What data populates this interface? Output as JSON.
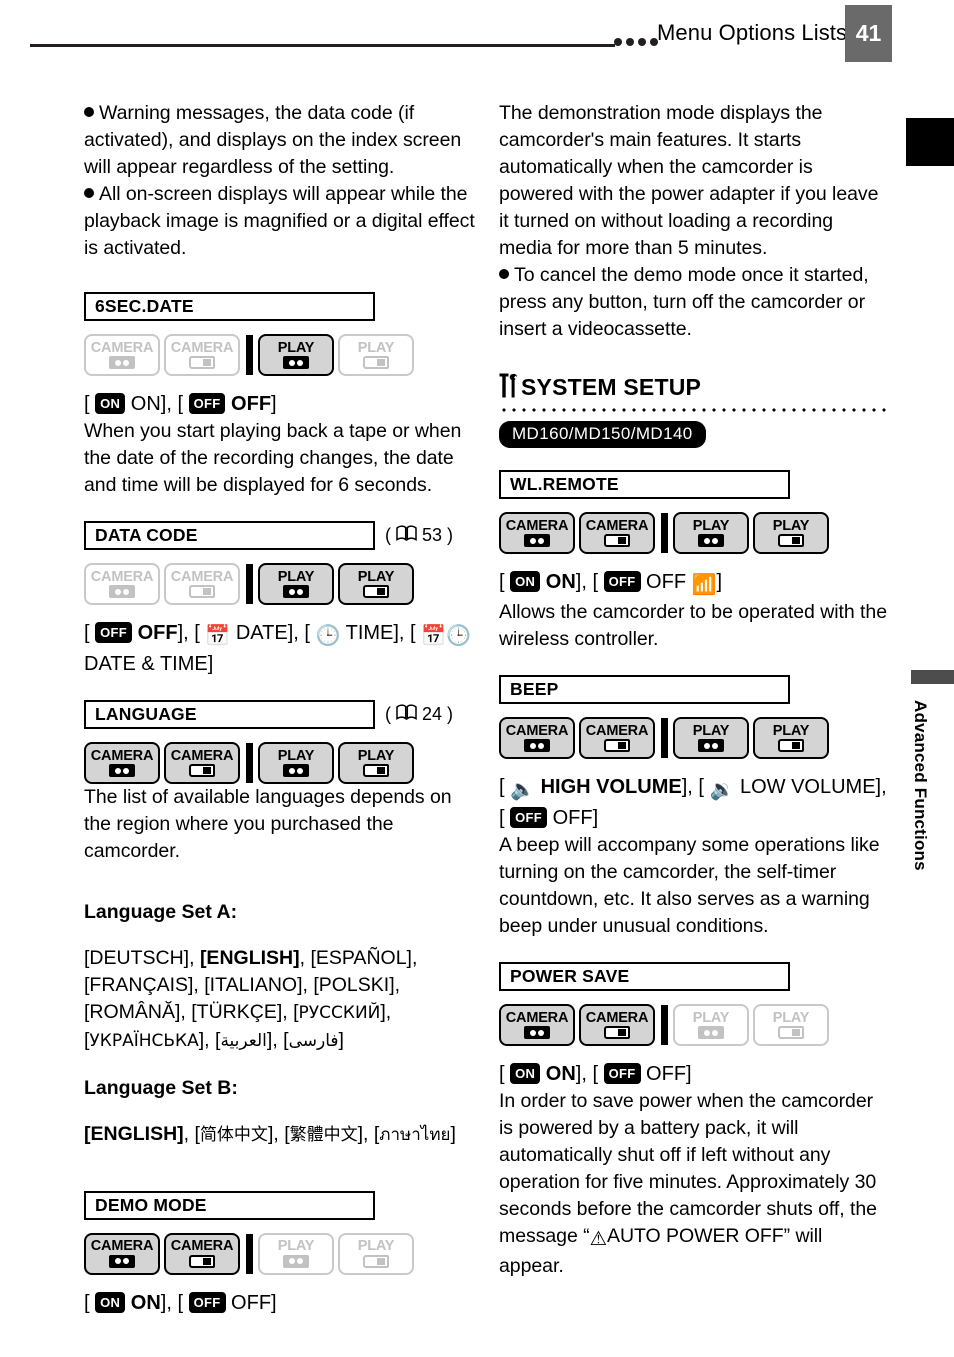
{
  "header": {
    "title": "Menu Options Lists",
    "page_number": "41",
    "dots_count": 4
  },
  "side_tab": {
    "vertical_label": "Advanced Functions"
  },
  "left_column": {
    "intro_bullets": [
      "Warning messages, the data code (if activated), and displays on the index screen will appear regardless of the setting.",
      "All on-screen displays will appear while the playback image is magnified or a digital effect is activated."
    ],
    "entries": [
      {
        "name": "6SEC.DATE",
        "page_ref": "",
        "modes": [
          {
            "label": "CAMERA",
            "icon": "tape-icon",
            "active": false
          },
          {
            "label": "CAMERA",
            "icon": "card-icon",
            "active": false
          },
          {
            "label": "PLAY",
            "icon": "tape-icon",
            "active": true
          },
          {
            "label": "PLAY",
            "icon": "card-icon",
            "active": false
          }
        ],
        "options_html": "[ <span class=\"pill\">ON</span> ON], [ <span class=\"pill\">OFF</span> <b>OFF</b>]",
        "description": "When you start playing back a tape or when the date of the recording changes, the date and time will be displayed for 6 seconds."
      },
      {
        "name": "DATA CODE",
        "page_ref": "53",
        "modes": [
          {
            "label": "CAMERA",
            "icon": "tape-icon",
            "active": false
          },
          {
            "label": "CAMERA",
            "icon": "card-icon",
            "active": false
          },
          {
            "label": "PLAY",
            "icon": "tape-icon",
            "active": true
          },
          {
            "label": "PLAY",
            "icon": "card-icon",
            "active": true
          }
        ],
        "options_html": "[ <span class=\"pill\">OFF</span> <b>OFF</b>], [ <span class=\"ic-inline\">&#x1F4C5;</span> DATE], [ <span class=\"ic-inline\">&#x1F552;</span> TIME], [ <span class=\"ic-inline\">&#x1F4C5;&#x1F552;</span> DATE &amp; TIME]",
        "description": ""
      },
      {
        "name": "LANGUAGE",
        "page_ref": "24",
        "modes": [
          {
            "label": "CAMERA",
            "icon": "tape-icon",
            "active": true
          },
          {
            "label": "CAMERA",
            "icon": "card-icon",
            "active": true
          },
          {
            "label": "PLAY",
            "icon": "tape-icon",
            "active": true
          },
          {
            "label": "PLAY",
            "icon": "card-icon",
            "active": true
          }
        ],
        "options_html": "",
        "description": "The list of available languages depends on the region where you purchased the camcorder."
      },
      {
        "name": "DEMO MODE",
        "page_ref": "",
        "modes": [
          {
            "label": "CAMERA",
            "icon": "tape-icon",
            "active": true
          },
          {
            "label": "CAMERA",
            "icon": "card-icon",
            "active": true
          },
          {
            "label": "PLAY",
            "icon": "tape-icon",
            "active": false
          },
          {
            "label": "PLAY",
            "icon": "card-icon",
            "active": false
          }
        ],
        "options_html": "[ <span class=\"pill\">ON</span> <b>ON</b>], [ <span class=\"pill\">OFF</span> OFF]",
        "description": ""
      }
    ],
    "language_sets": [
      {
        "heading": "Language Set A:",
        "items_html": "[DEUTSCH], <b>[ENGLISH]</b>, [ESPA&Ntilde;OL], [FRAN&Ccedil;AIS], [ITALIANO], [POLSKI], [ROM&Acirc;N&#258;], [T&Uuml;RK&Ccedil;E], [<span class=\"nonlatin\">&#1056;&#1059;&#1057;&#1057;&#1050;&#1048;&#1049;</span>], [<span class=\"nonlatin\">&#1059;&#1050;&#1056;&#1040;&#1031;&#1053;&#1057;&#1068;&#1050;&#1040;</span>], [<span class=\"nonlatin\">&#1575;&#1604;&#1593;&#1585;&#1576;&#1610;&#1577;</span>], [<span class=\"nonlatin\">&#1601;&#1575;&#1585;&#1587;&#1740;</span>]"
      },
      {
        "heading": "Language Set B:",
        "items_html": "<b>[ENGLISH]</b>, [<span class=\"nonlatin\">&#31616;&#20307;&#20013;&#25991;</span>], [<span class=\"nonlatin\">&#32321;&#39636;&#20013;&#25991;</span>], [<span class=\"nonlatin\">&#3616;&#3634;&#3625;&#3634;&#3652;&#3607;&#3618;</span>]"
      }
    ]
  },
  "right_column": {
    "intro_paragraph": "The demonstration mode displays the camcorder's main features. It starts automatically when the camcorder is powered with the power adapter if you leave it turned on without loading a recording media for more than 5 minutes.",
    "intro_bullet": "To cancel the demo mode once it started, press any button, turn off the camcorder or insert a videocassette.",
    "section": {
      "title": "SYSTEM SETUP",
      "icon": "screwdriver-wrench-icon",
      "model_badge": "MD160/MD150/MD140"
    },
    "entries": [
      {
        "name": "WL.REMOTE",
        "page_ref": "",
        "modes": [
          {
            "label": "CAMERA",
            "icon": "tape-icon",
            "active": true
          },
          {
            "label": "CAMERA",
            "icon": "card-icon",
            "active": true
          },
          {
            "label": "PLAY",
            "icon": "tape-icon",
            "active": true
          },
          {
            "label": "PLAY",
            "icon": "card-icon",
            "active": true
          }
        ],
        "options_html": "[ <span class=\"pill\">ON</span> <b>ON</b>], [ <span class=\"pill\">OFF</span> OFF <span class=\"ic-inline\" data-name=\"remote-off-icon\">&#128246;</span>]",
        "description": "Allows the camcorder to be operated with the wireless controller."
      },
      {
        "name": "BEEP",
        "page_ref": "",
        "modes": [
          {
            "label": "CAMERA",
            "icon": "tape-icon",
            "active": true
          },
          {
            "label": "CAMERA",
            "icon": "card-icon",
            "active": true
          },
          {
            "label": "PLAY",
            "icon": "tape-icon",
            "active": true
          },
          {
            "label": "PLAY",
            "icon": "card-icon",
            "active": true
          }
        ],
        "options_html": "[ <span class=\"ic-inline\" data-name=\"speaker-high-icon\">&#128264;</span> <b>HIGH VOLUME</b>], [ <span class=\"ic-inline\" data-name=\"speaker-low-icon\">&#128265;</span> LOW VOLUME], [ <span class=\"pill\">OFF</span> OFF]",
        "description": "A beep will accompany some operations like turning on the camcorder, the self-timer countdown, etc. It also serves as a warning beep under unusual conditions."
      },
      {
        "name": "POWER SAVE",
        "page_ref": "",
        "modes": [
          {
            "label": "CAMERA",
            "icon": "tape-icon",
            "active": true
          },
          {
            "label": "CAMERA",
            "icon": "card-icon",
            "active": true
          },
          {
            "label": "PLAY",
            "icon": "tape-icon",
            "active": false
          },
          {
            "label": "PLAY",
            "icon": "card-icon",
            "active": false
          }
        ],
        "options_html": "[ <span class=\"pill\">ON</span> <b>ON</b>], [ <span class=\"pill\">OFF</span> OFF]",
        "description_html": "In order to save power when the camcorder is powered by a battery pack, it will automatically shut off if left without any operation for five minutes. Approximately 30 seconds before the camcorder shuts off, the message &ldquo;<span class=\"ic-inline\" data-name=\"warning-triangle-icon\">&#9888;</span>AUTO POWER OFF&rdquo; will appear."
      }
    ]
  }
}
